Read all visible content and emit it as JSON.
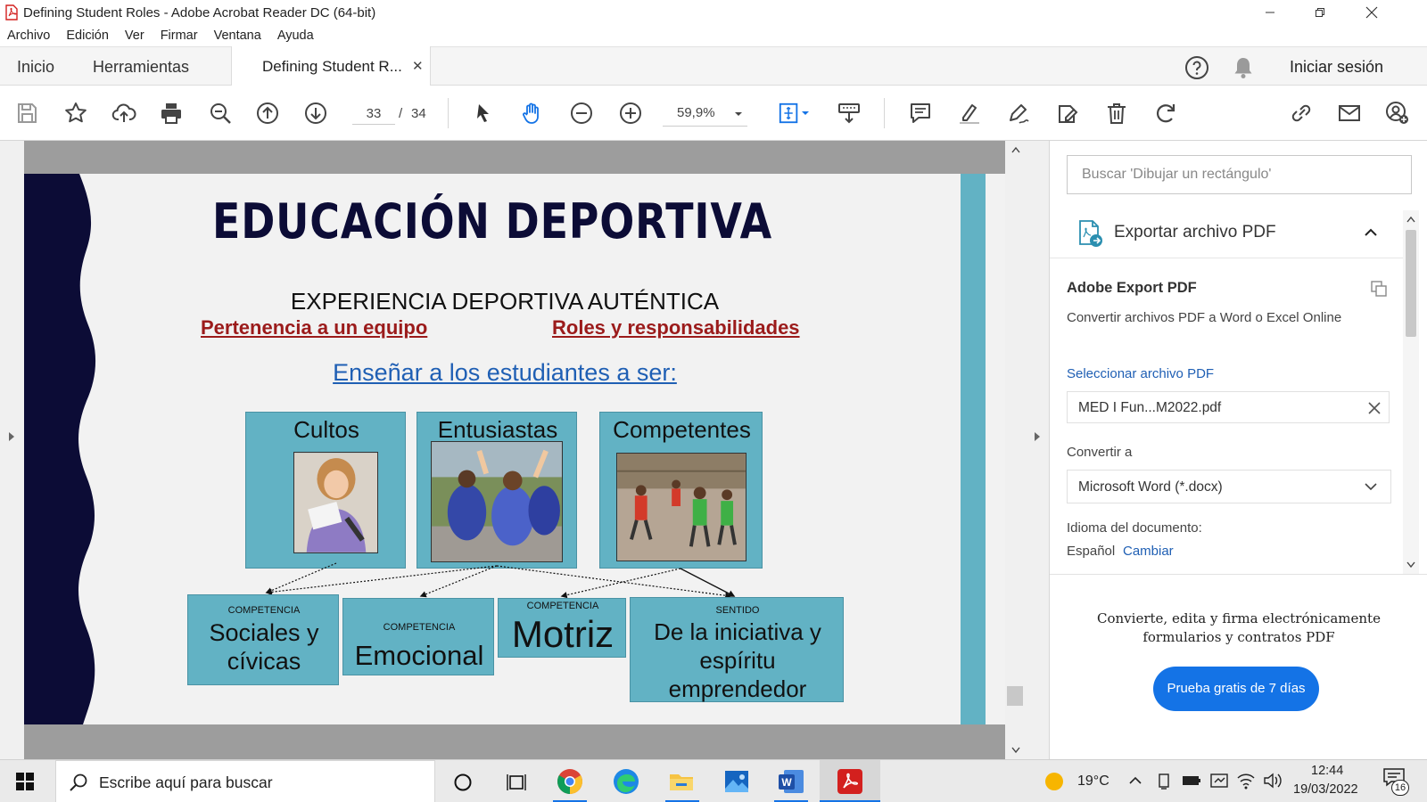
{
  "window": {
    "title": "Defining Student Roles - Adobe Acrobat Reader DC (64-bit)"
  },
  "menu": [
    "Archivo",
    "Edición",
    "Ver",
    "Firmar",
    "Ventana",
    "Ayuda"
  ],
  "tabs": {
    "home": "Inicio",
    "tools": "Herramientas",
    "document": "Defining Student R...",
    "sign_in": "Iniciar sesión"
  },
  "toolbar": {
    "current_page": "33",
    "page_sep": "/",
    "total_pages": "34",
    "zoom": "59,9%"
  },
  "slide": {
    "title": "EDUCACIÓN DEPORTIVA",
    "subtitle": "EXPERIENCIA DEPORTIVA  AUTÉNTICA",
    "link_left": "Pertenencia a un equipo",
    "link_right": "Roles y responsabilidades",
    "teach": "Enseñar a los estudiantes a ser:",
    "boxes": [
      "Cultos",
      "Entusiastas",
      "Competentes"
    ],
    "competences": [
      {
        "kicker": "COMPETENCIA",
        "label": "Sociales y cívicas"
      },
      {
        "kicker": "COMPETENCIA",
        "label": "Emocional"
      },
      {
        "kicker": "COMPETENCIA",
        "label": "Motriz"
      },
      {
        "kicker": "SENTIDO",
        "label": "De la iniciativa y espíritu emprendedor"
      }
    ]
  },
  "panel": {
    "search_placeholder": "Buscar 'Dibujar un rectángulo'",
    "export_header": "Exportar archivo PDF",
    "service_title": "Adobe Export PDF",
    "service_desc": "Convertir archivos PDF a Word o Excel Online",
    "select_file_label": "Seleccionar archivo PDF",
    "selected_file": "MED I Fun...M2022.pdf",
    "convert_label": "Convertir a",
    "convert_value": "Microsoft Word (*.docx)",
    "language_label": "Idioma del documento:",
    "language_value": "Español",
    "change_link": "Cambiar",
    "promo_text_1": "Convierte, edita y firma electrónicamente",
    "promo_text_2": "formularios y contratos PDF",
    "trial_button": "Prueba gratis de 7 días"
  },
  "taskbar": {
    "search_placeholder": "Escribe aquí para buscar",
    "temperature": "19°C",
    "time": "12:44",
    "date": "19/03/2022",
    "notifications": "16"
  },
  "colors": {
    "accent_blue": "#1473e6",
    "slide_teal": "#62b2c4",
    "slide_navy": "#0c0c36",
    "link_red": "#9b1b1b",
    "link_blue": "#1f5fb4"
  }
}
